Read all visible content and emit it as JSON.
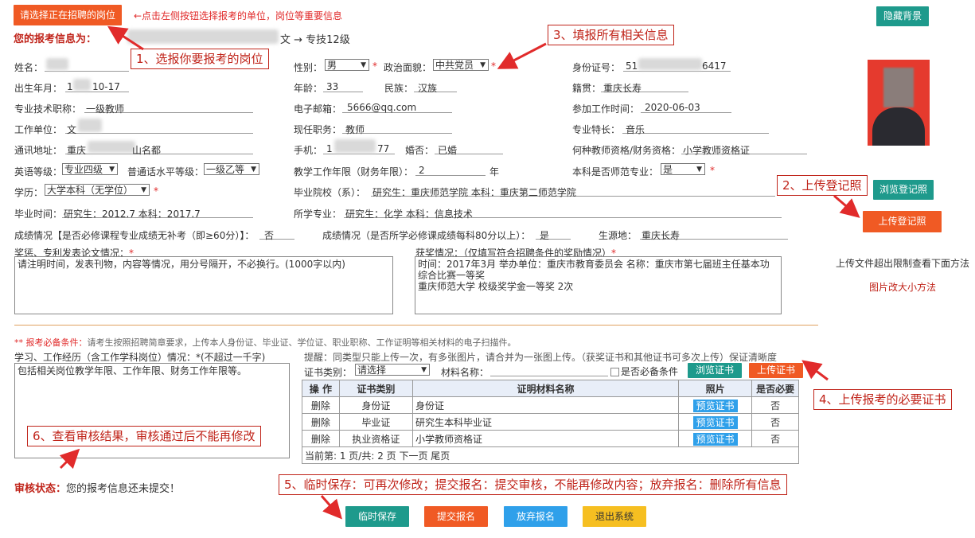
{
  "top": {
    "select_job_btn": "请选择正在招聘的岗位",
    "hint": "←点击左侧按钮选择报考的单位，岗位等重要信息",
    "hide_bg_btn": "隐藏背景",
    "info_label": "您的报考信息为：",
    "info_value": "文 → 专技12级"
  },
  "annotations": {
    "a1": "1、选报你要报考的岗位",
    "a2": "2、上传登记照",
    "a3": "3、填报所有相关信息",
    "a4": "4、上传报考的必要证书",
    "a5": "5、临时保存：可再次修改；提交报名：提交审核，不能再修改内容；放弃报名：删除所有信息",
    "a6": "6、查看审核结果，审核通过后不能再修改"
  },
  "form": {
    "name_label": "姓名：",
    "gender_label": "性别：",
    "gender_value": "男",
    "political_label": "政治面貌：",
    "political_value": "中共党员",
    "id_label": "身份证号：",
    "id_value_start": "51",
    "id_value_end": "6417",
    "birth_label": "出生年月：",
    "birth_value_start": "1",
    "birth_value_end": "10-17",
    "age_label": "年龄：",
    "age_value": "33",
    "nation_label": "民族：",
    "nation_value": "汉族",
    "native_label": "籍贯：",
    "native_value": "重庆长寿",
    "title_label": "专业技术职称：",
    "title_value": "一级教师",
    "email_label": "电子邮箱：",
    "email_value": "5666@qq.com",
    "workdate_label": "参加工作时间：",
    "workdate_value": "2020-06-03",
    "unit_label": "工作单位：",
    "unit_value": "文",
    "post_label": "现任职务：",
    "post_value": "教师",
    "specialty_label": "专业特长：",
    "specialty_value": "音乐",
    "address_label": "通讯地址：",
    "address_value_start": "重庆",
    "address_value_end": "山名都",
    "phone_label": "手机：",
    "phone_value_start": "1",
    "phone_value_end": "77",
    "marriage_label": "婚否：",
    "marriage_value": "已婚",
    "cert_label": "何种教师资格/财务资格：",
    "cert_value": "小学教师资格证",
    "english_label": "英语等级：",
    "english_value": "专业四级",
    "mandarin_label": "普通话水平等级：",
    "mandarin_value": "一级乙等",
    "teachyears_label": "教学工作年限（财务年限）：",
    "teachyears_value": "2",
    "teachyears_unit": "年",
    "normal_label": "本科是否师范专业：",
    "normal_value": "是",
    "edu_label": "学历：",
    "edu_value": "大学本科（无学位）",
    "school_label": "毕业院校（系）：",
    "school_value": "研究生：重庆师范学院  本科：重庆第二师范学院",
    "gradtime_label": "毕业时间：",
    "gradtime_value": "研究生：2012.7  本科：2017.7",
    "major_label": "所学专业：",
    "major_value": "研究生：化学  本科：信息技术",
    "grade1_label": "成绩情况【是否必修课程专业成绩无补考（即≥60分）】：",
    "grade1_value": "否",
    "grade2_label": "成绩情况（是否所学必修课成绩每科80分以上）：",
    "grade2_value": "是",
    "origin_label": "生源地：",
    "origin_value": "重庆长寿",
    "award_paper_label": "奖惩、专利发表论文情况：",
    "award_paper_value": "请注明时间，发表刊物，内容等情况，用分号隔开，不必换行。(1000字以内)",
    "award_label": "获奖情况：（仅填写符合招聘条件的奖励情况）",
    "award_value": "时间：2017年3月 举办单位：重庆市教育委员会 名称：重庆市第七届班主任基本功综合比赛一等奖\n重庆师范大学 校级奖学金一等奖 2次"
  },
  "side": {
    "browse_photo_btn": "浏览登记照",
    "upload_photo_btn": "上传登记照",
    "upload_limit": "上传文件超出限制查看下面方法",
    "resize_link": "图片改大小方法"
  },
  "required": {
    "label": "** 报考必备条件：",
    "text": "请考生按照招聘简章要求，上传本人身份证、毕业证、学位证、职业职称、工作证明等相关材料的电子扫描件。"
  },
  "experience": {
    "label": "学习、工作经历（含工作学科岗位）情况：*(不超过一千字)",
    "value": "包括相关岗位教学年限、工作年限、财务工作年限等。"
  },
  "upload": {
    "tip": "提醒：同类型只能上传一次，有多张图片，请合并为一张图上传。（获奖证书和其他证书可多次上传）保证清晰度",
    "cert_type_label": "证书类别：",
    "cert_type_value": "请选择",
    "material_label": "材料名称：",
    "required_check": "是否必备条件",
    "browse_btn": "浏览证书",
    "upload_btn": "上传证书",
    "headers": [
      "操 作",
      "证书类别",
      "证明材料名称",
      "照片",
      "是否必要"
    ],
    "rows": [
      {
        "op": "删除",
        "type": "身份证",
        "name": "身份证",
        "photo": "预览证书",
        "req": "否"
      },
      {
        "op": "删除",
        "type": "毕业证",
        "name": "研究生本科毕业证",
        "photo": "预览证书",
        "req": "否"
      },
      {
        "op": "删除",
        "type": "执业资格证",
        "name": "小学教师资格证",
        "photo": "预览证书",
        "req": "否"
      }
    ],
    "pager": "当前第: 1 页/共: 2 页 下一页 尾页"
  },
  "status": {
    "label": "审核状态：",
    "text": "您的报考信息还未提交！"
  },
  "actions": {
    "save": "临时保存",
    "submit": "提交报名",
    "abandon": "放弃报名",
    "exit": "退出系统"
  },
  "colors": {
    "orange": "#f05a24",
    "teal": "#1e9a8c",
    "blue": "#2fa0ea",
    "yellow": "#f6bf21",
    "annotation": "#c0241a"
  }
}
